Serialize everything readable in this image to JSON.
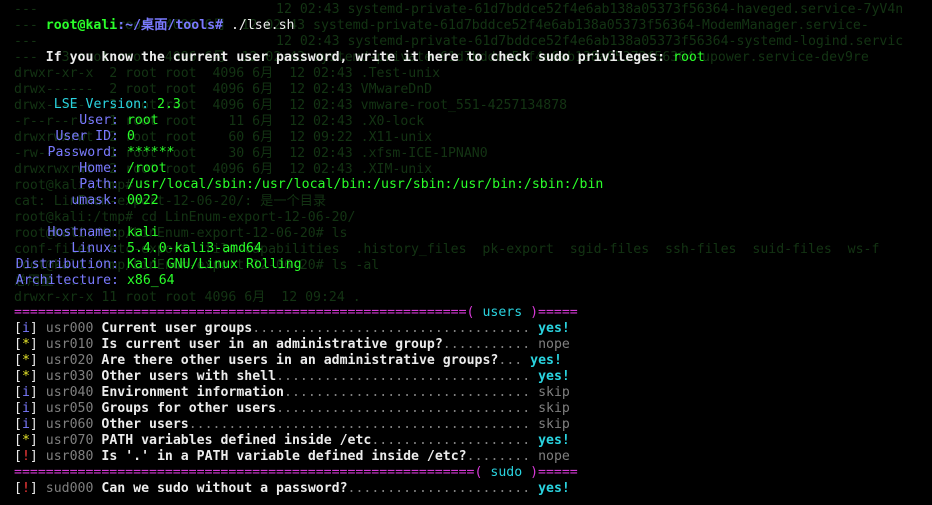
{
  "prompt": {
    "user_host": "root@kali",
    "path": ":~/桌面/tools#",
    "command": "./lse.sh"
  },
  "password_prompt": {
    "text": "If you know the current user password, write it here to check sudo privileges:",
    "value": "root"
  },
  "version": {
    "label": "LSE Version:",
    "value": "2.3"
  },
  "info": [
    {
      "label": "User:",
      "value": "root"
    },
    {
      "label": "User ID:",
      "value": "0"
    },
    {
      "label": "Password:",
      "value": "******"
    },
    {
      "label": "Home:",
      "value": "/root"
    },
    {
      "label": "Path:",
      "value": "/usr/local/sbin:/usr/local/bin:/usr/sbin:/usr/bin:/sbin:/bin"
    },
    {
      "label": "umask:",
      "value": "0022"
    }
  ],
  "system": [
    {
      "label": "Hostname:",
      "value": "kali"
    },
    {
      "label": "Linux:",
      "value": "5.4.0-kali3-amd64"
    },
    {
      "label": "Distribution:",
      "value": "Kali GNU/Linux Rolling"
    },
    {
      "label": "Architecture:",
      "value": "x86_64"
    }
  ],
  "sections": [
    {
      "name": "users",
      "bar_left": "=========================================================( ",
      "bar_right": " )=====",
      "checks": [
        {
          "marker": "i",
          "id": "usr000",
          "desc": "Current user groups",
          "dots": "...................................",
          "result": "yes!"
        },
        {
          "marker": "*",
          "id": "usr010",
          "desc": "Is current user in an administrative group?",
          "dots": "...........",
          "result": "nope"
        },
        {
          "marker": "*",
          "id": "usr020",
          "desc": "Are there other users in an administrative groups?",
          "dots": "...",
          "result": "yes!"
        },
        {
          "marker": "*",
          "id": "usr030",
          "desc": "Other users with shell",
          "dots": "................................",
          "result": "yes!"
        },
        {
          "marker": "i",
          "id": "usr040",
          "desc": "Environment information",
          "dots": "...............................",
          "result": "skip"
        },
        {
          "marker": "i",
          "id": "usr050",
          "desc": "Groups for other users",
          "dots": "................................",
          "result": "skip"
        },
        {
          "marker": "i",
          "id": "usr060",
          "desc": "Other users",
          "dots": "...........................................",
          "result": "skip"
        },
        {
          "marker": "*",
          "id": "usr070",
          "desc": "PATH variables defined inside /etc",
          "dots": "....................",
          "result": "yes!"
        },
        {
          "marker": "!",
          "id": "usr080",
          "desc": "Is '.' in a PATH variable defined inside /etc?",
          "dots": "........",
          "result": "nope"
        }
      ]
    },
    {
      "name": "sudo",
      "bar_left": "==========================================================( ",
      "bar_right": " )=====",
      "checks": [
        {
          "marker": "!",
          "id": "sud000",
          "desc": "Can we sudo without a password?",
          "dots": ".......................",
          "result": "yes!"
        }
      ]
    }
  ],
  "ghost_lines": [
    "---                              12 02:43 systemd-private-61d7bddce52f4e6ab138a05373f56364-haveged.service-7yV4n",
    "---   2 root root  4096 6月  12 02:43 systemd-private-61d7bddce52f4e6ab138a05373f56364-ModemManager.service-",
    "---                              12 02:43 systemd-private-61d7bddce52f4e6ab138a05373f56364-systemd-logind.servic",
    "---   3 root root  4096 6月  12 02:43 systemd-private-61d7bddce52f4e6ab138a05373f56364-upower.service-dev9re",
    "drwxr-xr-x  2 root root  4096 6月  12 02:43 .Test-unix",
    "drwx------  2 root root  4096 6月  12 02:43 VMwareDnD",
    "drwx------  2 root root  4096 6月  12 02:43 vmware-root_551-4257134878",
    "-r--r--r--  1 root root    11 6月  12 02:43 .X0-lock",
    "drwxrwxrwt  2 root root    60 6月  12 09:22 .X11-unix",
    "-rw-------  1 root root    30 6月  12 02:43 .xfsm-ICE-1PNAN0",
    "drwxrwxrwt  2 root root  4096 6月  12 02:43 .XIM-unix",
    "root@kali:/tmp# ",
    "cat: LinEnum-export-12-06-20/: 是一个目录",
    "root@kali:/tmp# cd LinEnum-export-12-06-20/",
    "root@kali:/tmp/LinEnum-export-12-06-20# ls",
    "conf-files  etc-export  file-capabilities  .history_files  pk-export  sgid-files  ssh-files  suid-files  ws-f",
    "root@kali:/tmp/LinEnum-export-12-06-20# ls -al",
    "总用量 ...",
    "drwxr-xr-x 11 root root 4096 6月  12 09:24 ."
  ]
}
